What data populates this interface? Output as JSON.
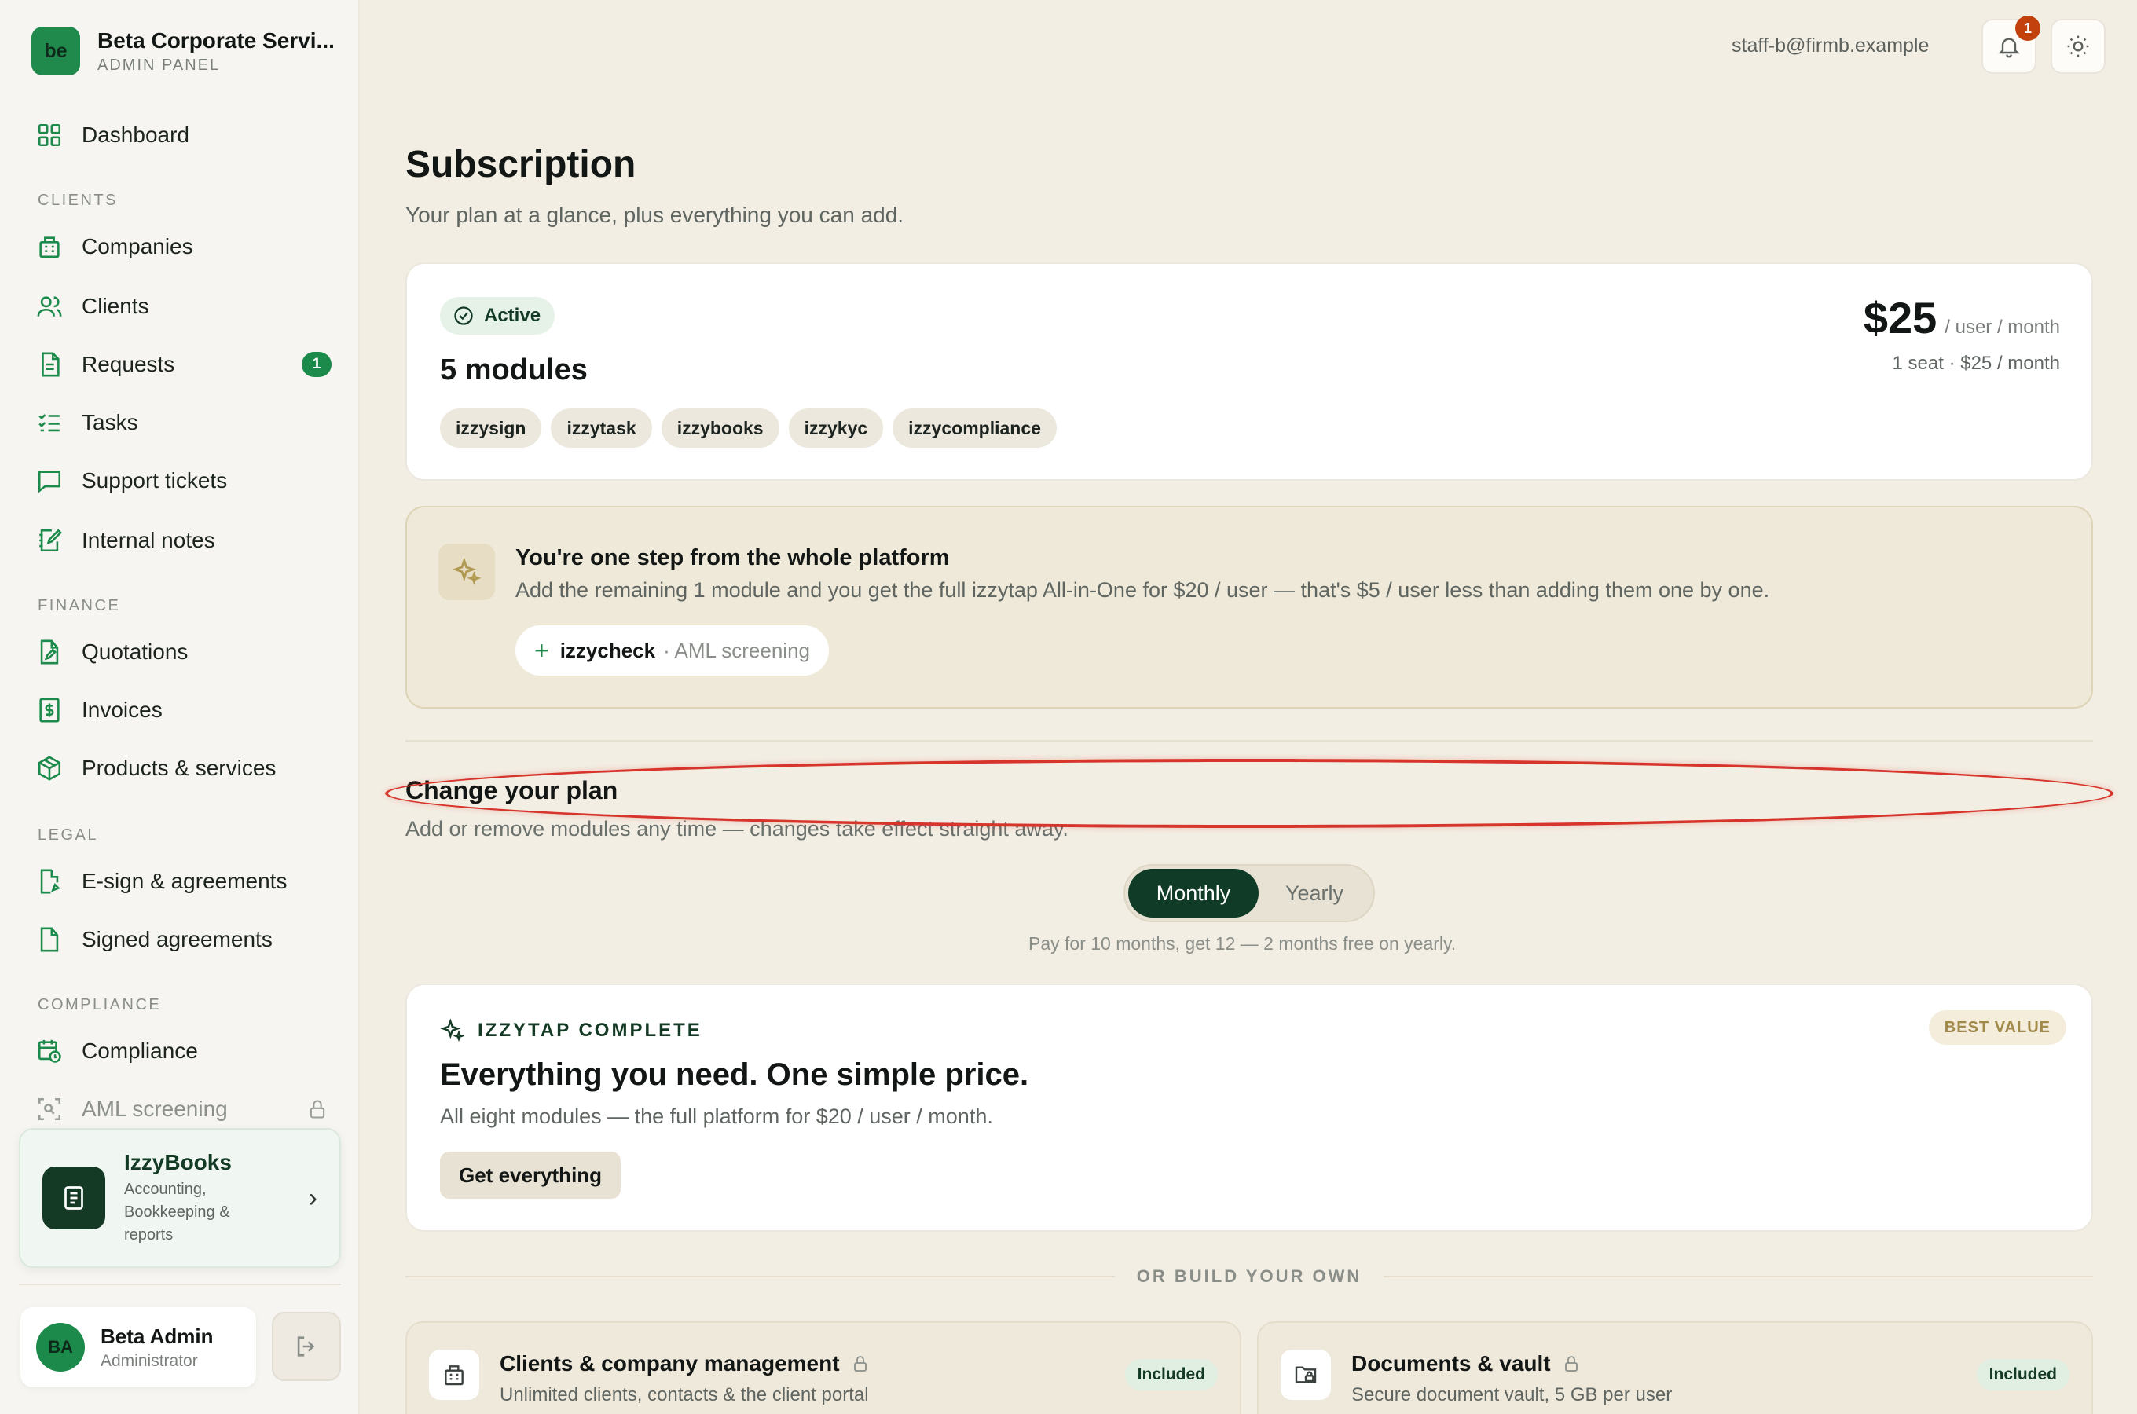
{
  "brand": {
    "logo_text": "be",
    "name": "Beta Corporate Servi...",
    "subtitle": "ADMIN PANEL"
  },
  "nav": {
    "dashboard": "Dashboard",
    "sections": {
      "clients": "CLIENTS",
      "finance": "FINANCE",
      "legal": "LEGAL",
      "compliance": "COMPLIANCE"
    },
    "companies": "Companies",
    "clients": "Clients",
    "requests": "Requests",
    "requests_badge": "1",
    "tasks": "Tasks",
    "support": "Support tickets",
    "notes": "Internal notes",
    "quotations": "Quotations",
    "invoices": "Invoices",
    "products": "Products & services",
    "esign": "E-sign & agreements",
    "signed": "Signed agreements",
    "compliance": "Compliance",
    "aml": "AML screening"
  },
  "promo": {
    "title": "IzzyBooks",
    "description": "Accounting, Bookkeeping & reports"
  },
  "user": {
    "initials": "BA",
    "name": "Beta Admin",
    "role": "Administrator"
  },
  "topbar": {
    "email": "staff-b@firmb.example",
    "notification_count": "1"
  },
  "page": {
    "title": "Subscription",
    "subtitle": "Your plan at a glance, plus everything you can add."
  },
  "plan": {
    "status": "Active",
    "modules_title": "5 modules",
    "modules": [
      "izzysign",
      "izzytask",
      "izzybooks",
      "izzykyc",
      "izzycompliance"
    ],
    "price": "$25",
    "price_unit": "/ user / month",
    "seat_summary": "1 seat · $25 / month"
  },
  "upsell": {
    "title": "You're one step from the whole platform",
    "description": "Add the remaining 1 module and you get the full izzytap All-in-One for $20 / user — that's $5 / user less than adding them one by one.",
    "module_name": "izzycheck",
    "module_desc": "· AML screening"
  },
  "change_plan": {
    "title": "Change your plan",
    "subtitle": "Add or remove modules any time — changes take effect straight away.",
    "toggle": {
      "monthly": "Monthly",
      "yearly": "Yearly",
      "selected": "Monthly"
    },
    "note": "Pay for 10 months, get 12 — 2 months free on yearly."
  },
  "bundle": {
    "eyebrow": "IZZYTAP COMPLETE",
    "title": "Everything you need. One simple price.",
    "description": "All eight modules — the full platform for $20 / user / month.",
    "button": "Get everything",
    "badge": "BEST VALUE"
  },
  "divider_text": "OR BUILD YOUR OWN",
  "modules_list": [
    {
      "title": "Clients & company management",
      "description": "Unlimited clients, contacts & the client portal",
      "badge": "Included"
    },
    {
      "title": "Documents & vault",
      "description": "Secure document vault, 5 GB per user",
      "badge": "Included"
    }
  ],
  "colors": {
    "brand_green": "#1b8a4a",
    "dark_green": "#103c27",
    "annotation_red": "#d7342b",
    "notification": "#c2410c"
  }
}
